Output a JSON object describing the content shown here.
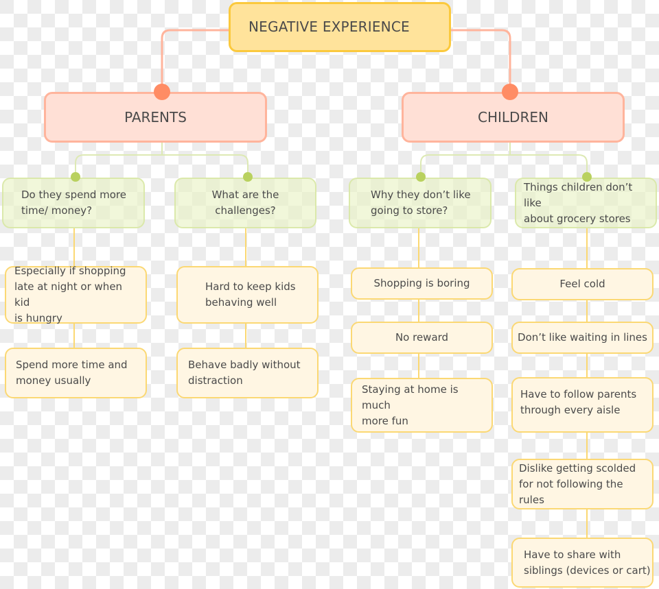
{
  "colors": {
    "root_fill": "#ffe39b",
    "root_border": "#fbc93d",
    "category_fill": "#ffe0d6",
    "category_border": "#ffb49c",
    "category_connector": "#ffb49c",
    "category_dot": "#ff8c64",
    "question_fill": "#eef5d6",
    "question_border": "#d6e6a0",
    "question_dot": "#b9d15f",
    "leaf_fill": "#fff6e3",
    "leaf_border": "#fbd873",
    "text": "#4a4a4a"
  },
  "root": {
    "label": "NEGATIVE EXPERIENCE"
  },
  "categories": [
    {
      "label": "PARENTS",
      "questions": [
        {
          "label": "Do they spend more\ntime/ money?",
          "items": [
            "Especially if shopping\nlate at night or when kid\nis hungry",
            "Spend more time and\nmoney usually"
          ]
        },
        {
          "label": "What are the\nchallenges?",
          "items": [
            "Hard to keep kids\nbehaving well",
            "Behave badly without\ndistraction"
          ]
        }
      ]
    },
    {
      "label": "CHILDREN",
      "questions": [
        {
          "label": "Why they don’t like\ngoing to store?",
          "items": [
            "Shopping is boring",
            "No reward",
            "Staying at home is much\nmore fun"
          ]
        },
        {
          "label": "Things children don’t like\nabout grocery stores",
          "items": [
            "Feel cold",
            "Don’t like waiting in lines",
            "Have to follow parents\nthrough every aisle",
            "Dislike getting scolded\nfor not following the rules",
            "Have to share with\nsiblings (devices or cart)"
          ]
        }
      ]
    }
  ]
}
